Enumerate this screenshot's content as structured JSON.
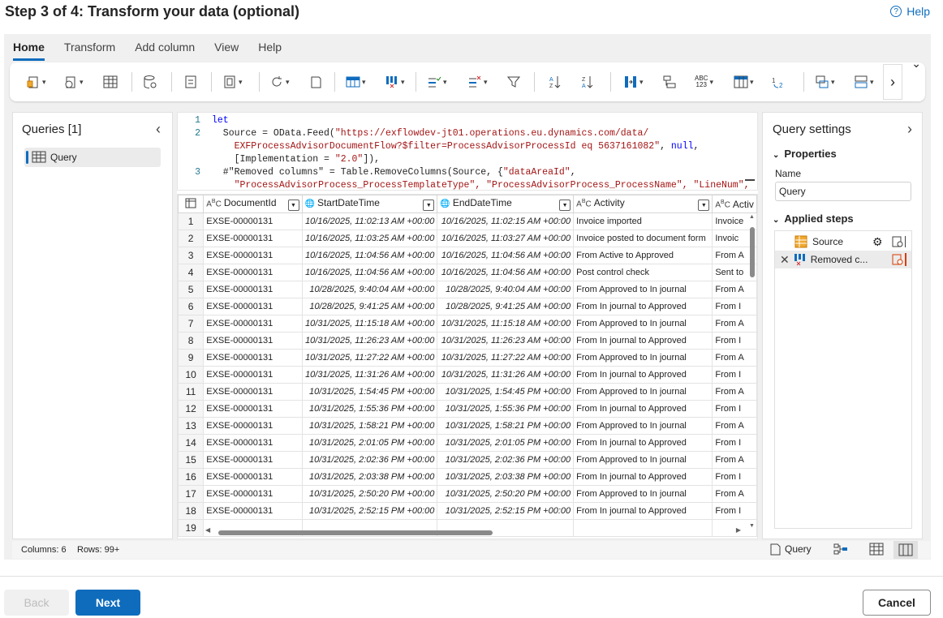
{
  "header": {
    "title": "Step 3 of 4: Transform your data (optional)",
    "help_label": "Help"
  },
  "tabs": [
    {
      "label": "Home",
      "active": true
    },
    {
      "label": "Transform"
    },
    {
      "label": "Add column"
    },
    {
      "label": "View"
    },
    {
      "label": "Help"
    }
  ],
  "ribbon": {
    "icons": [
      "get-data-icon",
      "recent-sources-icon",
      "enter-data-icon",
      "options-icon",
      "manage-parameters-icon",
      "refresh-icon",
      "properties-icon",
      "choose-columns-icon",
      "remove-columns-icon",
      "keep-rows-icon",
      "remove-rows-icon",
      "filter-icon",
      "sort-ascending-icon",
      "sort-descending-icon",
      "split-column-icon",
      "group-by-icon",
      "data-type-icon",
      "use-first-row-icon",
      "replace-values-icon",
      "merge-queries-icon",
      "append-queries-icon"
    ]
  },
  "queries": {
    "title": "Queries [1]",
    "items": [
      {
        "label": "Query"
      }
    ]
  },
  "formula": {
    "lines": [
      {
        "n": "1",
        "segments": [
          {
            "t": "let",
            "c": "kw"
          }
        ]
      },
      {
        "n": "2",
        "segments": [
          {
            "t": "  Source = OData.Feed(",
            "c": ""
          },
          {
            "t": "\"https://exflowdev-jt01.operations.eu.dynamics.com/data/",
            "c": "str"
          }
        ]
      },
      {
        "n": "",
        "segments": [
          {
            "t": "    EXFProcessAdvisorDocumentFlow?$filter=ProcessAdvisorProcessId eq 5637161082\"",
            "c": "str"
          },
          {
            "t": ", ",
            "c": ""
          },
          {
            "t": "null",
            "c": "kw"
          },
          {
            "t": ",",
            "c": ""
          }
        ]
      },
      {
        "n": "",
        "segments": [
          {
            "t": "    [Implementation = ",
            "c": ""
          },
          {
            "t": "\"2.0\"",
            "c": "str"
          },
          {
            "t": "]),",
            "c": ""
          }
        ]
      },
      {
        "n": "3",
        "segments": [
          {
            "t": "  #\"Removed columns\" = Table.RemoveColumns(Source, {",
            "c": ""
          },
          {
            "t": "\"dataAreaId\"",
            "c": "str"
          },
          {
            "t": ",",
            "c": ""
          }
        ]
      },
      {
        "n": "",
        "segments": [
          {
            "t": "    \"ProcessAdvisorProcess_ProcessTemplateType\", \"ProcessAdvisorProcess_ProcessName\", \"LineNum\",",
            "c": "str"
          }
        ]
      }
    ]
  },
  "grid": {
    "columns": [
      {
        "label": "DocumentId",
        "type": "ABC"
      },
      {
        "label": "StartDateTime",
        "type": "globe"
      },
      {
        "label": "EndDateTime",
        "type": "globe"
      },
      {
        "label": "Activity",
        "type": "ABC"
      },
      {
        "label": "Activ",
        "type": "ABC"
      }
    ],
    "rows": [
      {
        "n": "1",
        "doc": "EXSE-00000131",
        "start": "10/16/2025, 11:02:13 AM +00:00",
        "end": "10/16/2025, 11:02:15 AM +00:00",
        "act": "Invoice imported",
        "act2": "Invoice"
      },
      {
        "n": "2",
        "doc": "EXSE-00000131",
        "start": "10/16/2025, 11:03:25 AM +00:00",
        "end": "10/16/2025, 11:03:27 AM +00:00",
        "act": "Invoice posted to document form",
        "act2": "Invoic"
      },
      {
        "n": "3",
        "doc": "EXSE-00000131",
        "start": "10/16/2025, 11:04:56 AM +00:00",
        "end": "10/16/2025, 11:04:56 AM +00:00",
        "act": "From Active to Approved",
        "act2": "From A"
      },
      {
        "n": "4",
        "doc": "EXSE-00000131",
        "start": "10/16/2025, 11:04:56 AM +00:00",
        "end": "10/16/2025, 11:04:56 AM +00:00",
        "act": "Post control check",
        "act2": "Sent to"
      },
      {
        "n": "5",
        "doc": "EXSE-00000131",
        "start": "10/28/2025, 9:40:04 AM +00:00",
        "end": "10/28/2025, 9:40:04 AM +00:00",
        "act": "From Approved to In journal",
        "act2": "From A"
      },
      {
        "n": "6",
        "doc": "EXSE-00000131",
        "start": "10/28/2025, 9:41:25 AM +00:00",
        "end": "10/28/2025, 9:41:25 AM +00:00",
        "act": "From In journal to Approved",
        "act2": "From I"
      },
      {
        "n": "7",
        "doc": "EXSE-00000131",
        "start": "10/31/2025, 11:15:18 AM +00:00",
        "end": "10/31/2025, 11:15:18 AM +00:00",
        "act": "From Approved to In journal",
        "act2": "From A"
      },
      {
        "n": "8",
        "doc": "EXSE-00000131",
        "start": "10/31/2025, 11:26:23 AM +00:00",
        "end": "10/31/2025, 11:26:23 AM +00:00",
        "act": "From In journal to Approved",
        "act2": "From I"
      },
      {
        "n": "9",
        "doc": "EXSE-00000131",
        "start": "10/31/2025, 11:27:22 AM +00:00",
        "end": "10/31/2025, 11:27:22 AM +00:00",
        "act": "From Approved to In journal",
        "act2": "From A"
      },
      {
        "n": "10",
        "doc": "EXSE-00000131",
        "start": "10/31/2025, 11:31:26 AM +00:00",
        "end": "10/31/2025, 11:31:26 AM +00:00",
        "act": "From In journal to Approved",
        "act2": "From I"
      },
      {
        "n": "11",
        "doc": "EXSE-00000131",
        "start": "10/31/2025, 1:54:45 PM +00:00",
        "end": "10/31/2025, 1:54:45 PM +00:00",
        "act": "From Approved to In journal",
        "act2": "From A"
      },
      {
        "n": "12",
        "doc": "EXSE-00000131",
        "start": "10/31/2025, 1:55:36 PM +00:00",
        "end": "10/31/2025, 1:55:36 PM +00:00",
        "act": "From In journal to Approved",
        "act2": "From I"
      },
      {
        "n": "13",
        "doc": "EXSE-00000131",
        "start": "10/31/2025, 1:58:21 PM +00:00",
        "end": "10/31/2025, 1:58:21 PM +00:00",
        "act": "From Approved to In journal",
        "act2": "From A"
      },
      {
        "n": "14",
        "doc": "EXSE-00000131",
        "start": "10/31/2025, 2:01:05 PM +00:00",
        "end": "10/31/2025, 2:01:05 PM +00:00",
        "act": "From In journal to Approved",
        "act2": "From I"
      },
      {
        "n": "15",
        "doc": "EXSE-00000131",
        "start": "10/31/2025, 2:02:36 PM +00:00",
        "end": "10/31/2025, 2:02:36 PM +00:00",
        "act": "From Approved to In journal",
        "act2": "From A"
      },
      {
        "n": "16",
        "doc": "EXSE-00000131",
        "start": "10/31/2025, 2:03:38 PM +00:00",
        "end": "10/31/2025, 2:03:38 PM +00:00",
        "act": "From In journal to Approved",
        "act2": "From I"
      },
      {
        "n": "17",
        "doc": "EXSE-00000131",
        "start": "10/31/2025, 2:50:20 PM +00:00",
        "end": "10/31/2025, 2:50:20 PM +00:00",
        "act": "From Approved to In journal",
        "act2": "From A"
      },
      {
        "n": "18",
        "doc": "EXSE-00000131",
        "start": "10/31/2025, 2:52:15 PM +00:00",
        "end": "10/31/2025, 2:52:15 PM +00:00",
        "act": "From In journal to Approved",
        "act2": "From I"
      },
      {
        "n": "19",
        "doc": "",
        "start": "",
        "end": "",
        "act": "",
        "act2": ""
      }
    ]
  },
  "settings": {
    "title": "Query settings",
    "properties_label": "Properties",
    "name_label": "Name",
    "name_value": "Query",
    "applied_steps_label": "Applied steps",
    "steps": [
      {
        "label": "Source"
      },
      {
        "label": "Removed c..."
      }
    ]
  },
  "status": {
    "columns": "Columns: 6",
    "rows": "Rows: 99+",
    "query_label": "Query"
  },
  "footer": {
    "back": "Back",
    "next": "Next",
    "cancel": "Cancel"
  },
  "colors": {
    "accent": "#0f6cbd",
    "panel_bg": "#f0f0f0",
    "warning": "#d83b01"
  }
}
